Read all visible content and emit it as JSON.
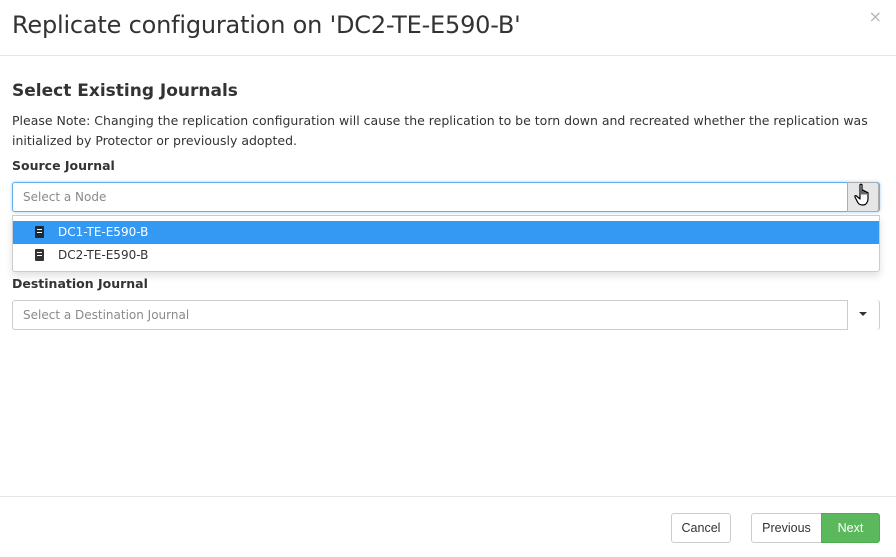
{
  "modal": {
    "title": "Replicate configuration on 'DC2-TE-E590-B'",
    "close_symbol": "×"
  },
  "content": {
    "heading": "Select Existing Journals",
    "note": "Please Note: Changing the replication configuration will cause the replication to be torn down and recreated whether the replication was initialized by Protector or previously adopted."
  },
  "source_journal": {
    "label": "Source Journal",
    "placeholder": "Select a Node",
    "dropdown_open": true,
    "options": [
      {
        "label": "DC1-TE-E590-B",
        "icon": "node-icon",
        "highlighted": true
      },
      {
        "label": "DC2-TE-E590-B",
        "icon": "node-icon",
        "highlighted": false
      }
    ]
  },
  "destination_journal": {
    "label": "Destination Journal",
    "placeholder": "Select a Destination Journal"
  },
  "footer": {
    "cancel_label": "Cancel",
    "previous_label": "Previous",
    "next_label": "Next"
  },
  "colors": {
    "highlight": "#3399f3",
    "next_button": "#5cb85c"
  }
}
